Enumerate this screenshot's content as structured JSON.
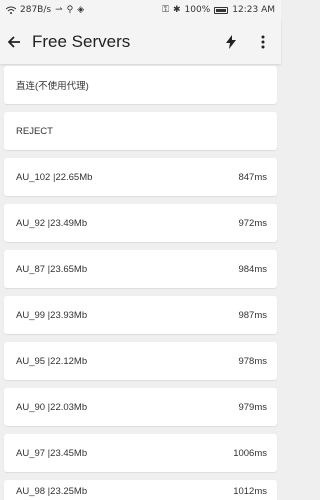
{
  "status": {
    "speed": "287B/s",
    "battery": "100%",
    "time": "12:23 AM"
  },
  "appbar": {
    "title": "Free Servers"
  },
  "servers": [
    {
      "name": "直连(不使用代理)",
      "latency": ""
    },
    {
      "name": "REJECT",
      "latency": ""
    },
    {
      "name": "AU_102 |22.65Mb",
      "latency": "847ms"
    },
    {
      "name": "AU_92 |23.49Mb",
      "latency": "972ms"
    },
    {
      "name": "AU_87 |23.65Mb",
      "latency": "984ms"
    },
    {
      "name": "AU_99 |23.93Mb",
      "latency": "987ms"
    },
    {
      "name": "AU_95 |22.12Mb",
      "latency": "978ms"
    },
    {
      "name": "AU_90 |22.03Mb",
      "latency": "979ms"
    },
    {
      "name": "AU_97 |23.45Mb",
      "latency": "1006ms"
    },
    {
      "name": "AU_98 |23.25Mb",
      "latency": "1012ms"
    }
  ]
}
